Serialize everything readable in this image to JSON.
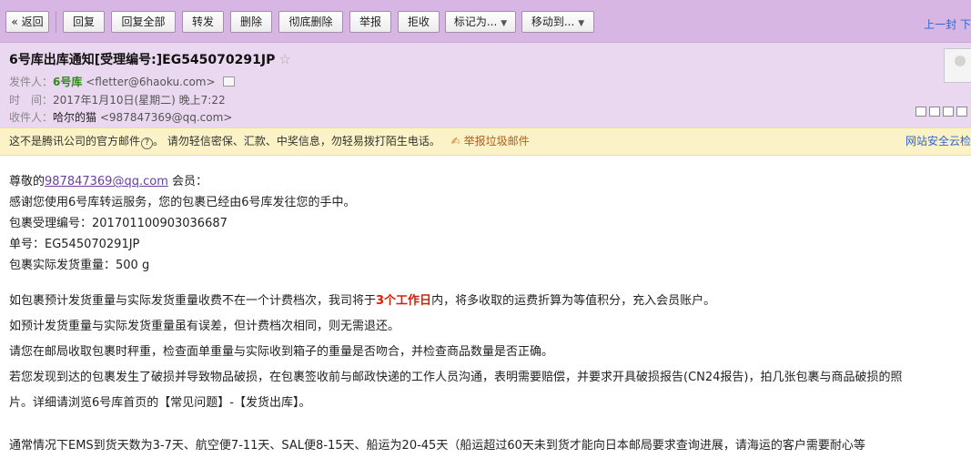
{
  "toolbar": {
    "buttons": [
      "« 返回",
      "回复",
      "回复全部",
      "转发",
      "删除",
      "彻底删除",
      "举报",
      "拒收",
      "标记为...",
      "移动到..."
    ],
    "right_link": "上一封 下"
  },
  "email": {
    "subject": "6号库出库通知[受理编号:]EG545070291JP",
    "star": "☆",
    "from_label": "发件人：",
    "from_name": "6号库",
    "from_addr": "<fletter@6haoku.com>",
    "time_label": "时　间：",
    "time": "2017年1月10日(星期二) 晚上7:22",
    "to_label": "收件人：",
    "to_name": "哈尔的猫",
    "to_addr": "<987847369@qq.com>"
  },
  "warning": {
    "text1": "这不是腾讯公司的官方邮件",
    "q": "?",
    "text2": "。  请勿轻信密保、汇款、中奖信息，勿轻易拨打陌生电话。",
    "report": "举报垃圾邮件",
    "right": "网站安全云检"
  },
  "body": {
    "greet_pre": "尊敬的",
    "greet_link": "987847369@qq.com",
    "greet_post": " 会员：",
    "l1": "感谢您使用6号库转运服务，您的包裹已经由6号库发往您的手中。",
    "l2": "包裹受理编号：201701100903036687",
    "l3": "单号：EG545070291JP",
    "l4": "包裹实际发货重量：500 g",
    "p1_pre": "如包裹预计发货重量与实际发货重量收费不在一个计费档次，我司将于",
    "p1_red": "3个工作日",
    "p1_post": "内，将多收取的运费折算为等值积分，充入会员账户。",
    "p2": "如预计发货重量与实际发货重量虽有误差，但计费档次相同，则无需退还。",
    "p3": "请您在邮局收取包裹时秤重，检查面单重量与实际收到箱子的重量是否吻合，并检查商品数量是否正确。",
    "p4": "若您发现到达的包裹发生了破损并导致物品破损，在包裹签收前与邮政快递的工作人员沟通，表明需要赔偿，并要求开具破损报告(CN24报告)，拍几张包裹与商品破损的照",
    "p5": "片。详细请浏览6号库首页的【常见问题】-【发货出库】。",
    "p6": "通常情况下EMS到货天数为3-7天、航空便7-11天、SAL便8-15天、船运为20-45天（船运超过60天未到货才能向日本邮局要求查询进展，请海运的客户需要耐心等"
  }
}
